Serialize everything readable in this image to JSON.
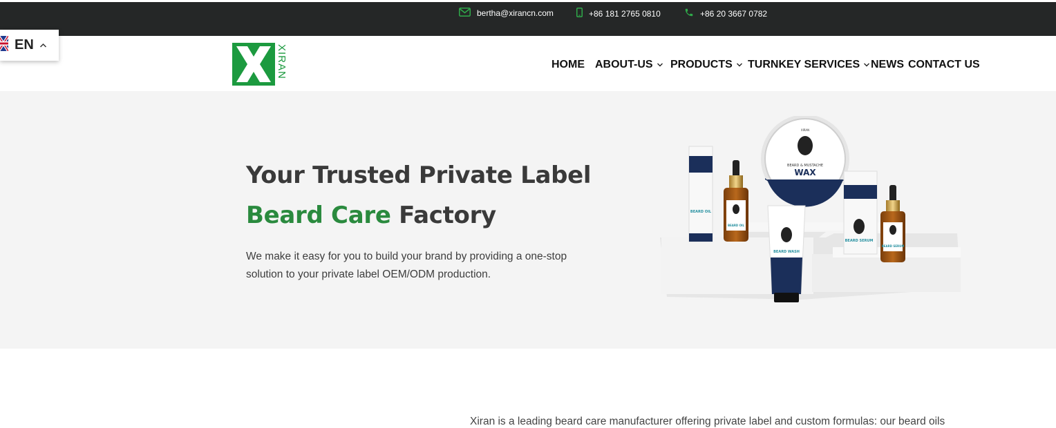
{
  "topbar": {
    "email": "bertha@xirancn.com",
    "mobile": "+86 181 2765 0810",
    "phone": "+86 20 3667 0782"
  },
  "brand": {
    "logo_text": "XIRAN",
    "accent": "#1c9a3f"
  },
  "language": {
    "label": "EN"
  },
  "nav": {
    "items": [
      {
        "label": "HOME"
      },
      {
        "label": "ABOUT-US"
      },
      {
        "label": "PRODUCTS"
      },
      {
        "label": "TURNKEY SERVICES"
      },
      {
        "label": "NEWS"
      },
      {
        "label": "CONTACT US"
      }
    ]
  },
  "hero": {
    "title_line1": "Your Trusted Private Label",
    "title_green": "Beard Care",
    "title_rest": "Factory",
    "description": "We make it easy for you to build your brand by providing a one-stop solution to your private label OEM/ODM production.",
    "product_labels": {
      "brand": "XIRAN",
      "wax_top": "BEARD & MUSTACHE",
      "wax": "WAX",
      "oil": "BEARD OIL",
      "wash": "BEARD WASH",
      "serum": "BEARD SERUM"
    }
  },
  "intro": {
    "text": "Xiran is a leading beard care manufacturer offering private label and custom formulas: our beard oils"
  }
}
